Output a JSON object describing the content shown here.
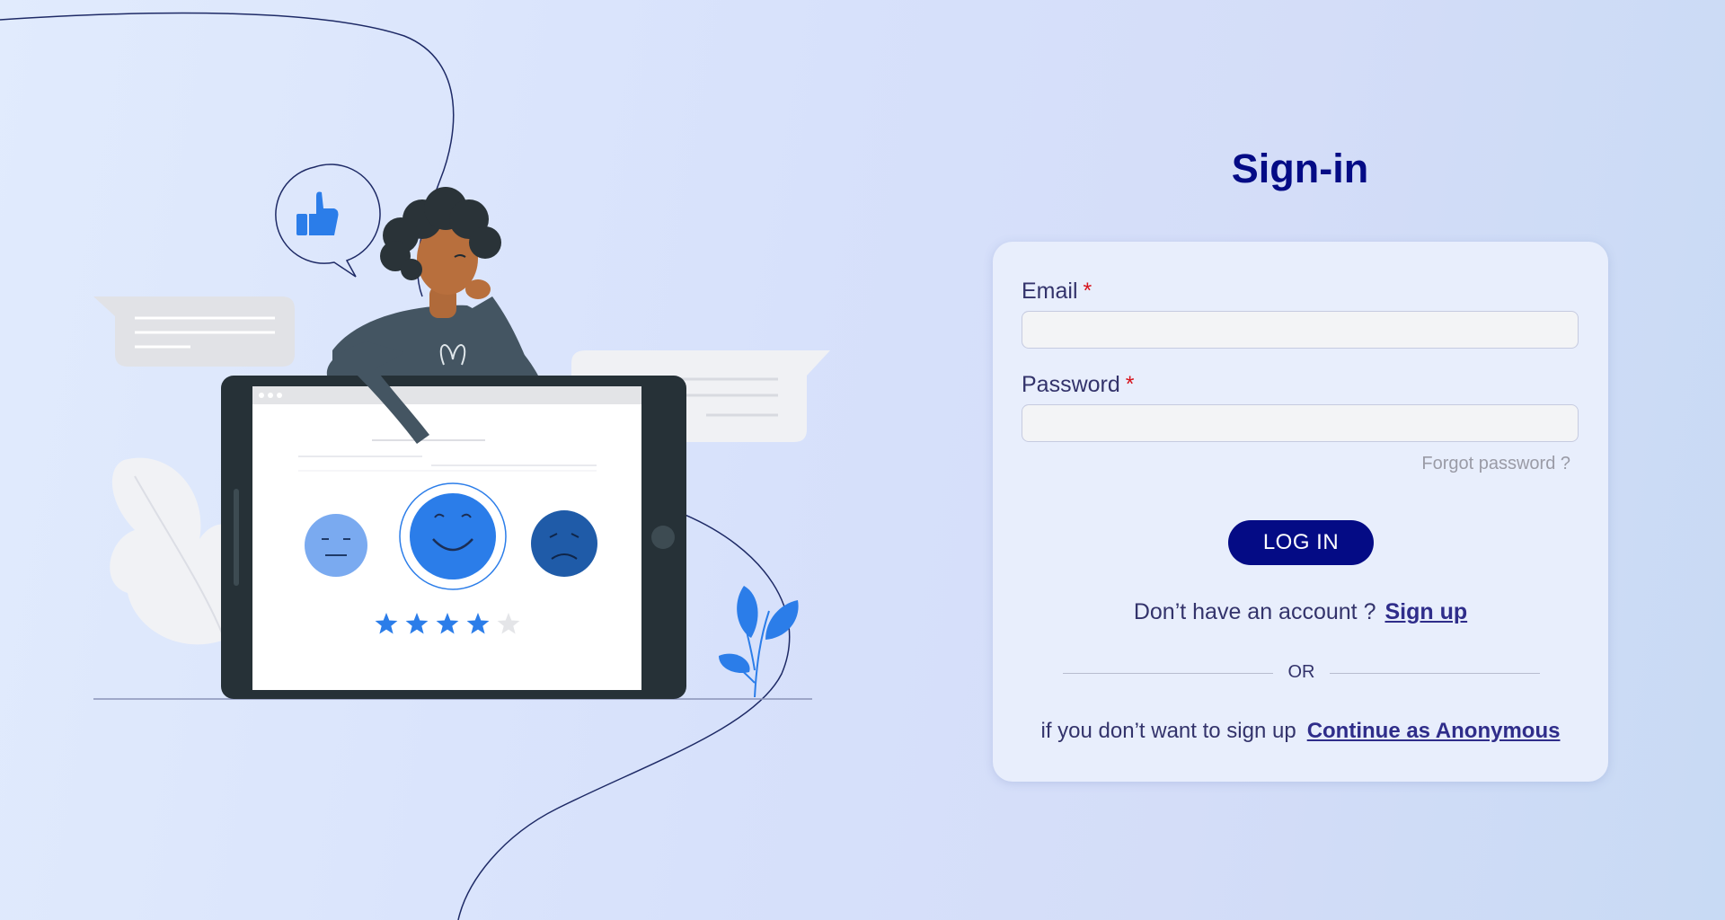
{
  "page": {
    "title": "Sign-in"
  },
  "form": {
    "email_label": "Email",
    "password_label": "Password",
    "required_mark": "*",
    "email_value": "",
    "password_value": "",
    "forgot_password": "Forgot password ?",
    "login_button": "LOG IN",
    "no_account_text": "Don’t have an account ?",
    "signup_link": "Sign up",
    "or_text": "OR",
    "anonymous_text": "if you don’t want to sign up",
    "anonymous_link": "Continue as Anonymous"
  },
  "illustration": {
    "rating_stars": 4,
    "rating_max": 5
  },
  "colors": {
    "accent": "#040b85",
    "required": "#d6141c",
    "link": "#2f2d8a",
    "illustration_blue": "#2b7de9"
  }
}
